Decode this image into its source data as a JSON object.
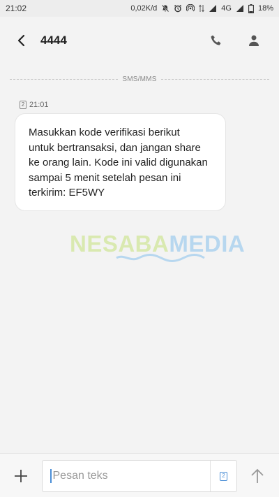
{
  "status_bar": {
    "time": "21:02",
    "speed": "0,02K/d",
    "network": "4G",
    "battery": "18%"
  },
  "header": {
    "title": "4444"
  },
  "conversation": {
    "divider_label": "SMS/MMS",
    "messages": [
      {
        "sim": "2",
        "time": "21:01",
        "text": "Masukkan kode verifikasi berikut\nuntuk bertransaksi, dan jangan share\nke orang lain. Kode ini valid digunakan\nsampai 5 menit setelah pesan ini\nterkirim: EF5WY"
      }
    ]
  },
  "watermark": {
    "part1": "NESABA",
    "part2": "MEDIA"
  },
  "composer": {
    "placeholder": "Pesan teks",
    "sim_label": "2"
  },
  "colors": {
    "background": "#f3f3f3",
    "bubble": "#ffffff",
    "accent": "#4a8ed6"
  }
}
